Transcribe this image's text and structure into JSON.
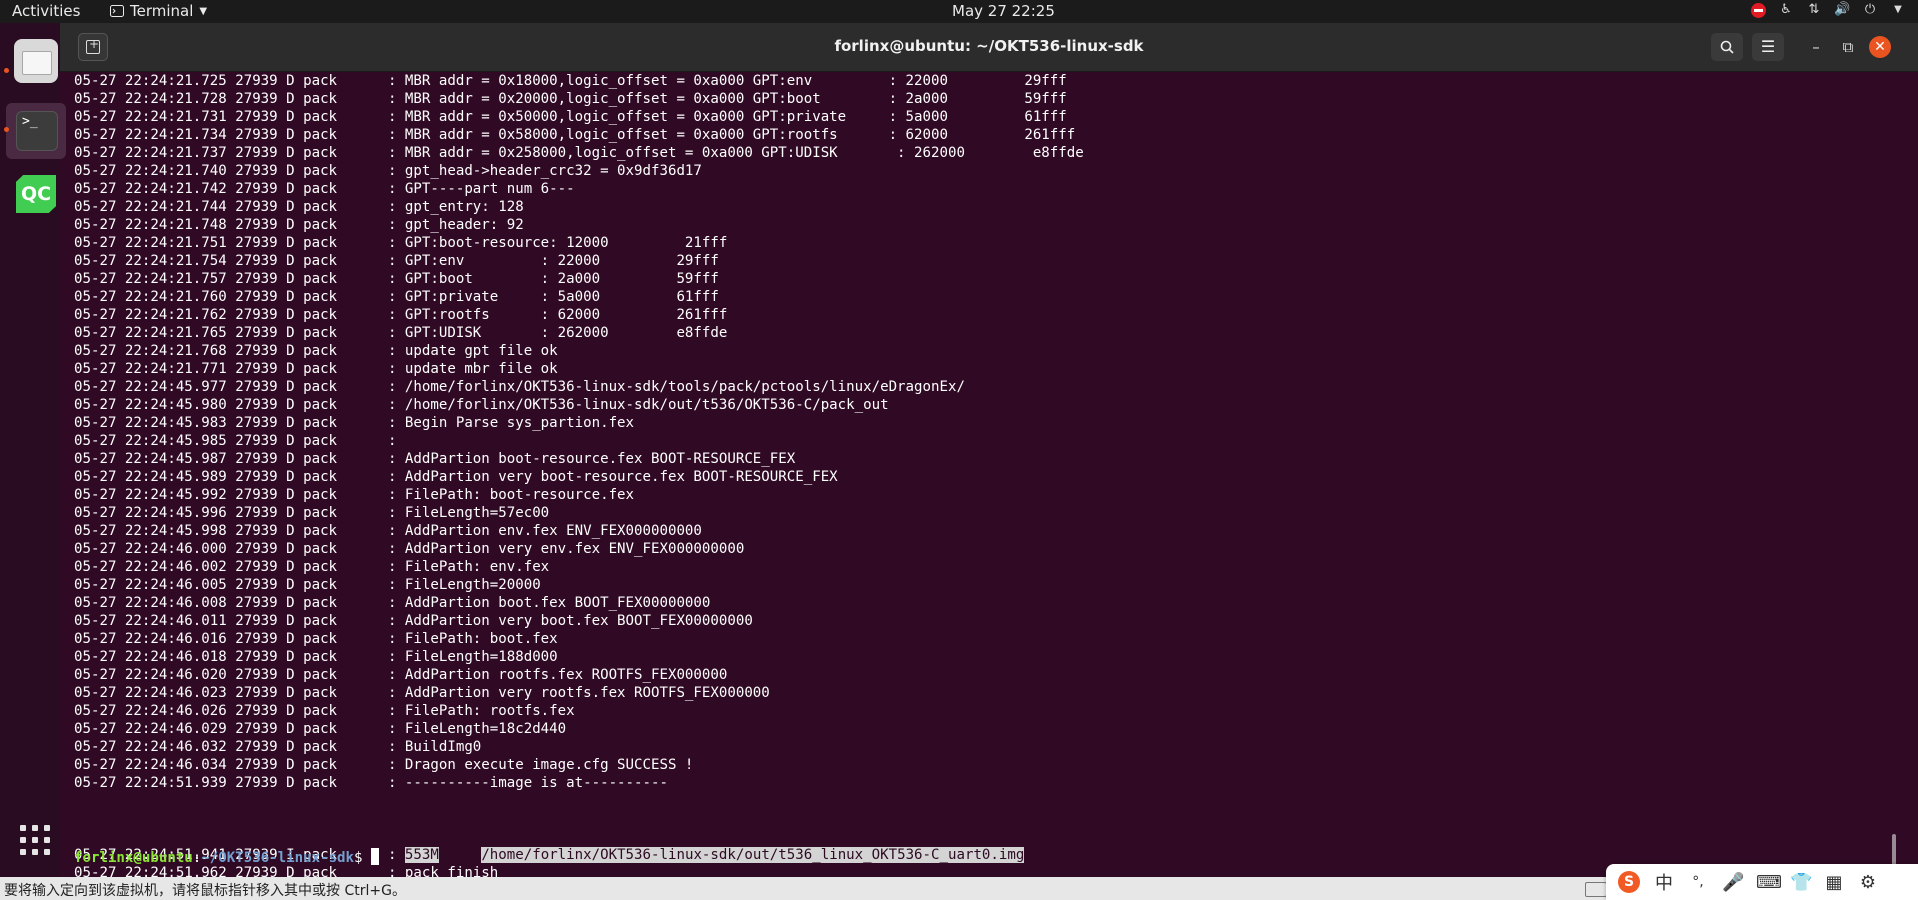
{
  "topbar": {
    "activities": "Activities",
    "app_name": "Terminal",
    "clock": "May 27  22:25"
  },
  "dock": {
    "items": [
      "files-icon",
      "terminal-icon",
      "qt-creator-icon"
    ],
    "qt_label": "QC"
  },
  "window": {
    "title": "forlinx@ubuntu: ~/OKT536-linux-sdk"
  },
  "terminal": {
    "lines": [
      "05-27 22:24:21.725 27939 D pack      : MBR addr = 0x18000,logic_offset = 0xa000 GPT:env         : 22000         29fff",
      "05-27 22:24:21.728 27939 D pack      : MBR addr = 0x20000,logic_offset = 0xa000 GPT:boot        : 2a000         59fff",
      "05-27 22:24:21.731 27939 D pack      : MBR addr = 0x50000,logic_offset = 0xa000 GPT:private     : 5a000         61fff",
      "05-27 22:24:21.734 27939 D pack      : MBR addr = 0x58000,logic_offset = 0xa000 GPT:rootfs      : 62000         261fff",
      "05-27 22:24:21.737 27939 D pack      : MBR addr = 0x258000,logic_offset = 0xa000 GPT:UDISK       : 262000        e8ffde",
      "05-27 22:24:21.740 27939 D pack      : gpt_head->header_crc32 = 0x9df36d17",
      "05-27 22:24:21.742 27939 D pack      : GPT----part num 6---",
      "05-27 22:24:21.744 27939 D pack      : gpt_entry: 128",
      "05-27 22:24:21.748 27939 D pack      : gpt_header: 92",
      "05-27 22:24:21.751 27939 D pack      : GPT:boot-resource: 12000         21fff",
      "05-27 22:24:21.754 27939 D pack      : GPT:env         : 22000         29fff",
      "05-27 22:24:21.757 27939 D pack      : GPT:boot        : 2a000         59fff",
      "05-27 22:24:21.760 27939 D pack      : GPT:private     : 5a000         61fff",
      "05-27 22:24:21.762 27939 D pack      : GPT:rootfs      : 62000         261fff",
      "05-27 22:24:21.765 27939 D pack      : GPT:UDISK       : 262000        e8ffde",
      "05-27 22:24:21.768 27939 D pack      : update gpt file ok",
      "05-27 22:24:21.771 27939 D pack      : update mbr file ok",
      "05-27 22:24:45.977 27939 D pack      : /home/forlinx/OKT536-linux-sdk/tools/pack/pctools/linux/eDragonEx/",
      "05-27 22:24:45.980 27939 D pack      : /home/forlinx/OKT536-linux-sdk/out/t536/OKT536-C/pack_out",
      "05-27 22:24:45.983 27939 D pack      : Begin Parse sys_partion.fex",
      "05-27 22:24:45.985 27939 D pack      :",
      "05-27 22:24:45.987 27939 D pack      : AddPartion boot-resource.fex BOOT-RESOURCE_FEX",
      "05-27 22:24:45.989 27939 D pack      : AddPartion very boot-resource.fex BOOT-RESOURCE_FEX",
      "05-27 22:24:45.992 27939 D pack      : FilePath: boot-resource.fex",
      "05-27 22:24:45.996 27939 D pack      : FileLength=57ec00",
      "05-27 22:24:45.998 27939 D pack      : AddPartion env.fex ENV_FEX000000000",
      "05-27 22:24:46.000 27939 D pack      : AddPartion very env.fex ENV_FEX000000000",
      "05-27 22:24:46.002 27939 D pack      : FilePath: env.fex",
      "05-27 22:24:46.005 27939 D pack      : FileLength=20000",
      "05-27 22:24:46.008 27939 D pack      : AddPartion boot.fex BOOT_FEX00000000",
      "05-27 22:24:46.011 27939 D pack      : AddPartion very boot.fex BOOT_FEX00000000",
      "05-27 22:24:46.016 27939 D pack      : FilePath: boot.fex",
      "05-27 22:24:46.018 27939 D pack      : FileLength=188d000",
      "05-27 22:24:46.020 27939 D pack      : AddPartion rootfs.fex ROOTFS_FEX000000",
      "05-27 22:24:46.023 27939 D pack      : AddPartion very rootfs.fex ROOTFS_FEX000000",
      "05-27 22:24:46.026 27939 D pack      : FilePath: rootfs.fex",
      "05-27 22:24:46.029 27939 D pack      : FileLength=18c2d440",
      "05-27 22:24:46.032 27939 D pack      : BuildImg0",
      "05-27 22:24:46.034 27939 D pack      : Dragon execute image.cfg SUCCESS !",
      "05-27 22:24:51.939 27939 D pack      : ----------image is at----------"
    ],
    "image_line": {
      "prefix": "05-27 22:24:51.941 27939 I pack      : ",
      "size": "553M",
      "gap": "     ",
      "path": "/home/forlinx/OKT536-linux-sdk/out/t536_linux_OKT536-C_uart0.img"
    },
    "final_line": "05-27 22:24:51.962 27939 D pack      : pack finish",
    "prompt": {
      "user": "forlinx@ubuntu",
      "sep": ":",
      "path": "~/OKT536-linux-sdk",
      "symbol": "$ "
    }
  },
  "bottombar": {
    "hint": "要将输入定向到该虚拟机，请将鼠标指针移入其中或按 Ctrl+G。"
  },
  "ime": {
    "logo": "S",
    "lang": "中",
    "punct": "°,"
  }
}
